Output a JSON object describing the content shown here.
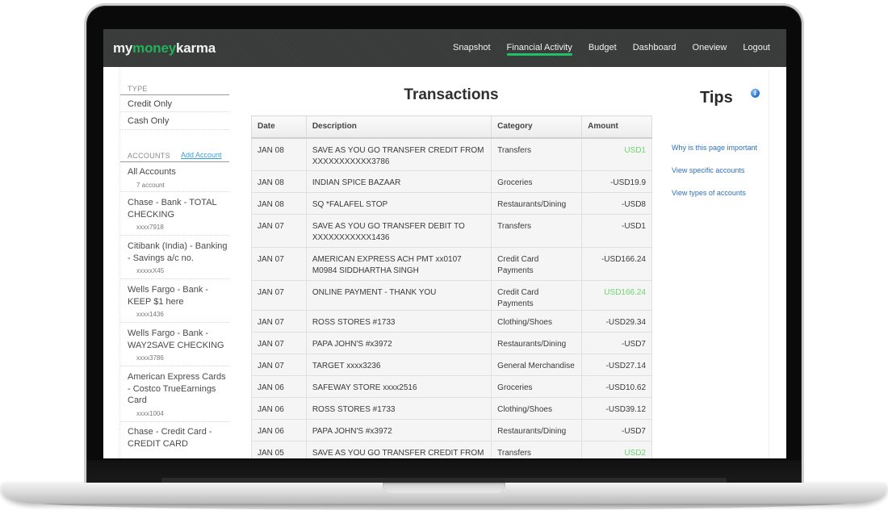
{
  "brand": {
    "part1": "my",
    "part2": "money",
    "part3": "karma"
  },
  "nav": {
    "items": [
      {
        "label": "Snapshot",
        "active": false
      },
      {
        "label": "Financial Activity",
        "active": true
      },
      {
        "label": "Budget",
        "active": false
      },
      {
        "label": "Dashboard",
        "active": false
      },
      {
        "label": "Oneview",
        "active": false
      },
      {
        "label": "Logout",
        "active": false
      }
    ]
  },
  "sidebar": {
    "type_label": "TYPE",
    "type_items": [
      "Credit Only",
      "Cash Only"
    ],
    "accounts_label": "ACCOUNTS",
    "add_account_label": "Add Account",
    "accounts": [
      {
        "name": "All Accounts",
        "sub": "7 account"
      },
      {
        "name": "Chase - Bank - TOTAL CHECKING",
        "sub": "xxxx7918"
      },
      {
        "name": "Citibank (India) - Banking - Savings a/c no.",
        "sub": "xxxxxX45"
      },
      {
        "name": "Wells Fargo - Bank - KEEP $1 here",
        "sub": "xxxx1436"
      },
      {
        "name": "Wells Fargo - Bank - WAY2SAVE CHECKING",
        "sub": "xxxx3786"
      },
      {
        "name": "American Express Cards - Costco TrueEarnings Card",
        "sub": "xxxx1004"
      },
      {
        "name": "Chase - Credit Card - CREDIT CARD",
        "sub": ""
      }
    ]
  },
  "main": {
    "title": "Transactions",
    "columns": [
      "Date",
      "Description",
      "Category",
      "Amount"
    ],
    "rows": [
      {
        "date": "JAN 08",
        "description": "SAVE AS YOU GO TRANSFER CREDIT FROM XXXXXXXXXXX3786",
        "category": "Transfers",
        "amount": "USD1",
        "positive": true
      },
      {
        "date": "JAN 08",
        "description": "INDIAN SPICE BAZAAR",
        "category": "Groceries",
        "amount": "-USD19.9",
        "positive": false
      },
      {
        "date": "JAN 08",
        "description": "SQ *FALAFEL STOP",
        "category": "Restaurants/Dining",
        "amount": "-USD8",
        "positive": false
      },
      {
        "date": "JAN 07",
        "description": "SAVE AS YOU GO TRANSFER DEBIT TO XXXXXXXXXXX1436",
        "category": "Transfers",
        "amount": "-USD1",
        "positive": false
      },
      {
        "date": "JAN 07",
        "description": "AMERICAN EXPRESS ACH PMT xx0107 M0984 SIDDHARTHA SINGH",
        "category": "Credit Card Payments",
        "amount": "-USD166.24",
        "positive": false
      },
      {
        "date": "JAN 07",
        "description": "ONLINE PAYMENT - THANK YOU",
        "category": "Credit Card Payments",
        "amount": "USD166.24",
        "positive": true
      },
      {
        "date": "JAN 07",
        "description": "ROSS STORES #1733",
        "category": "Clothing/Shoes",
        "amount": "-USD29.34",
        "positive": false
      },
      {
        "date": "JAN 07",
        "description": "PAPA JOHN'S #x3972",
        "category": "Restaurants/Dining",
        "amount": "-USD7",
        "positive": false
      },
      {
        "date": "JAN 07",
        "description": "TARGET xxxx3236",
        "category": "General Merchandise",
        "amount": "-USD27.14",
        "positive": false
      },
      {
        "date": "JAN 06",
        "description": "SAFEWAY STORE xxxx2516",
        "category": "Groceries",
        "amount": "-USD10.62",
        "positive": false
      },
      {
        "date": "JAN 06",
        "description": "ROSS STORES #1733",
        "category": "Clothing/Shoes",
        "amount": "-USD39.12",
        "positive": false
      },
      {
        "date": "JAN 06",
        "description": "PAPA JOHN'S #x3972",
        "category": "Restaurants/Dining",
        "amount": "-USD7",
        "positive": false
      },
      {
        "date": "JAN 05",
        "description": "SAVE AS YOU GO TRANSFER CREDIT FROM",
        "category": "Transfers",
        "amount": "USD2",
        "positive": true
      }
    ]
  },
  "tips": {
    "title": "Tips",
    "info_icon": "info-icon",
    "links": [
      "Why is this page important",
      "View specific accounts",
      "View types of accounts"
    ]
  },
  "colors": {
    "accent_green": "#21b35a",
    "positive_amount": "#6dd46d",
    "link_blue": "#2f6fb7",
    "navbar_bg": "#393a3a"
  }
}
